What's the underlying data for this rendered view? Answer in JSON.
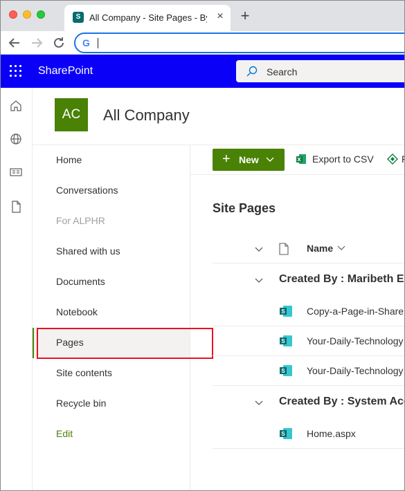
{
  "browser": {
    "tab_title": "All Company - Site Pages - By",
    "tab_close": "×",
    "new_tab": "+",
    "favicon_letter": "S",
    "google_letter": "G"
  },
  "suitebar": {
    "brand": "SharePoint",
    "search_label": "Search",
    "bg_color": "#0b00f7"
  },
  "site": {
    "logo_initials": "AC",
    "title": "All Company",
    "accent_color": "#498205"
  },
  "leftnav": {
    "items": [
      {
        "label": "Home"
      },
      {
        "label": "Conversations"
      },
      {
        "label": "For ALPHR"
      },
      {
        "label": "Shared with us"
      },
      {
        "label": "Documents"
      },
      {
        "label": "Notebook"
      },
      {
        "label": "Pages"
      },
      {
        "label": "Site contents"
      },
      {
        "label": "Recycle bin"
      },
      {
        "label": "Edit"
      }
    ],
    "selected": "Pages"
  },
  "commandbar": {
    "new_label": "New",
    "new_plus": "+",
    "export_label": "Export to CSV",
    "more_label": "F"
  },
  "list": {
    "title": "Site Pages",
    "column_name": "Name",
    "groups": [
      {
        "label": "Created By : Maribeth Es",
        "files": [
          "Copy-a-Page-in-Share",
          "Your-Daily-Technology",
          "Your-Daily-Technology"
        ]
      },
      {
        "label": "Created By : System Acc",
        "files": [
          "Home.aspx"
        ]
      }
    ]
  }
}
